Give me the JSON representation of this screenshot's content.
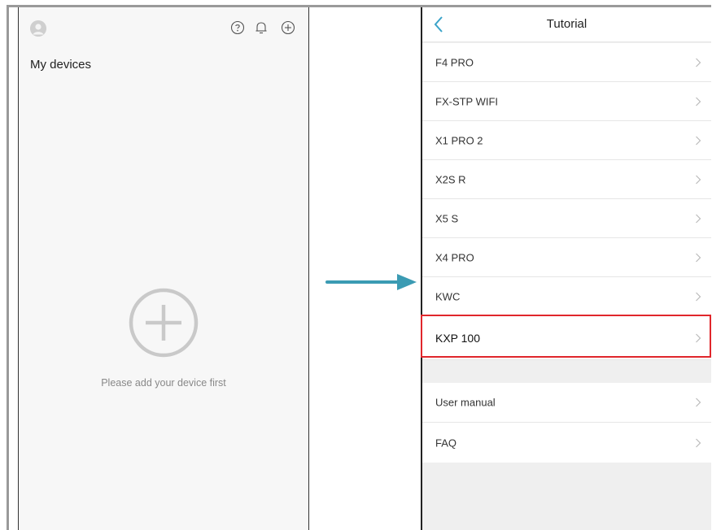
{
  "left_screen": {
    "title": "My devices",
    "empty_hint": "Please add your device first",
    "icons": [
      "avatar-icon",
      "help-icon",
      "notification-bell-icon",
      "add-icon",
      "add-device-icon"
    ]
  },
  "right_screen": {
    "title": "Tutorial",
    "devices": [
      {
        "label": "F4 PRO"
      },
      {
        "label": "FX-STP WIFI"
      },
      {
        "label": "X1 PRO 2"
      },
      {
        "label": "X2S R"
      },
      {
        "label": "X5 S"
      },
      {
        "label": "X4 PRO"
      },
      {
        "label": "KWC"
      },
      {
        "label": "KXP 100"
      }
    ],
    "highlighted_device": "KXP 100",
    "other_items": [
      {
        "label": "User manual"
      },
      {
        "label": "FAQ"
      }
    ]
  },
  "colors": {
    "arrow": "#3b9bb3",
    "highlight_border": "#e0262b",
    "back_chevron": "#3aa3c9"
  }
}
